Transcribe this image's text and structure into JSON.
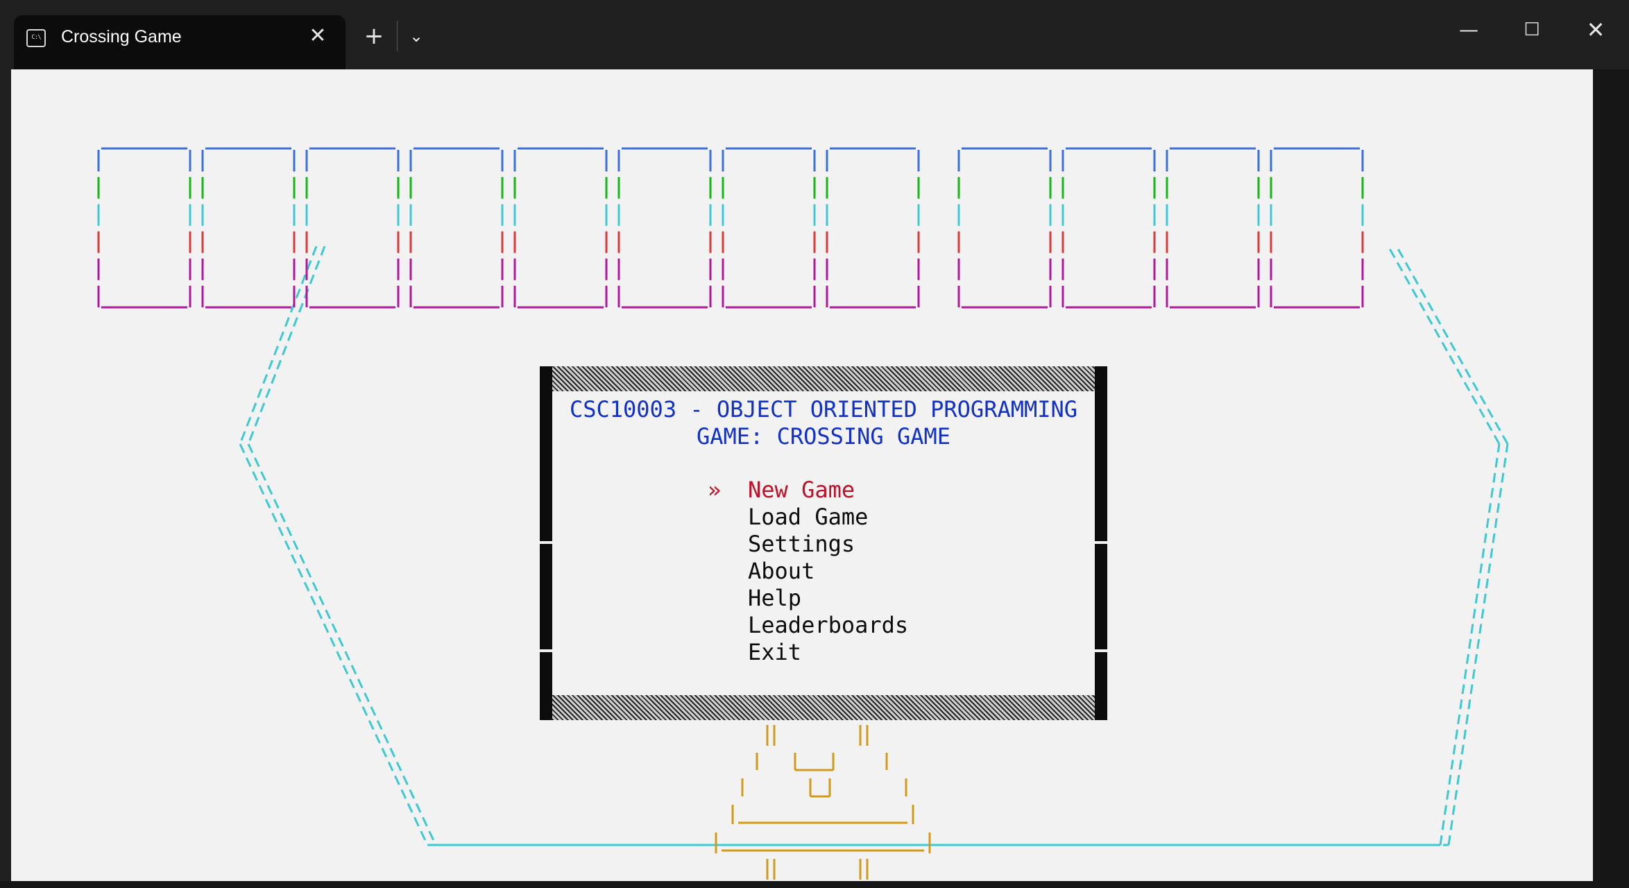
{
  "window": {
    "tab_title": "Crossing Game",
    "tab_icon": "terminal-icon",
    "tab_icon_glyph": "C:\\",
    "close_tab_glyph": "✕",
    "new_tab_glyph": "+",
    "dropdown_glyph": "⌄",
    "minimize_glyph": "—",
    "maximize_glyph": "☐",
    "close_glyph": "✕"
  },
  "menu": {
    "heading_line1": "CSC10003 - OBJECT ORIENTED PROGRAMMING",
    "heading_line2": "GAME: CROSSING GAME",
    "pointer": "»",
    "items": [
      "New Game",
      "Load Game",
      "Settings",
      "About",
      "Help",
      "Leaderboards",
      "Exit"
    ],
    "selected_index": 0
  },
  "art": {
    "title_text": "CROSSING GAME",
    "title_colors": [
      "#3b6fd9",
      "#14b814",
      "#3ec8d0",
      "#d93a3a",
      "#b0179a",
      "#b0179a"
    ],
    "frame_color": "#3ec8d0",
    "stand_color": "#d09a1a",
    "menu_heading_color": "#1030c8",
    "menu_selected_color": "#c01028"
  }
}
